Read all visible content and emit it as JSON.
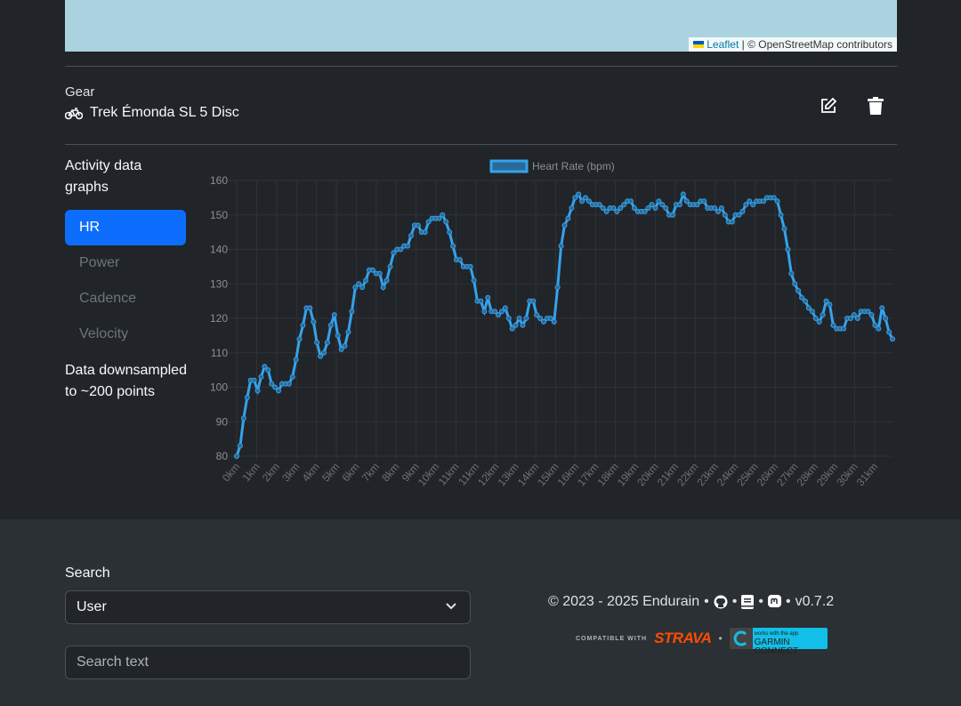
{
  "map": {
    "attribution_link": "Leaflet",
    "attribution_text": "| © OpenStreetMap contributors"
  },
  "gear": {
    "label": "Gear",
    "value": "Trek Émonda SL 5 Disc",
    "icon": "bicycle-icon"
  },
  "sidebar": {
    "title": "Activity data graphs",
    "tabs": [
      {
        "label": "HR",
        "active": true
      },
      {
        "label": "Power"
      },
      {
        "label": "Cadence"
      },
      {
        "label": "Velocity"
      }
    ],
    "note": "Data downsampled to ~200 points"
  },
  "chart_data": {
    "type": "line",
    "legend": "Heart Rate (bpm)",
    "legend_position": "top",
    "color": "#36a2eb",
    "ylim": [
      80,
      160
    ],
    "yticks": [
      80,
      90,
      100,
      110,
      120,
      130,
      140,
      150,
      160
    ],
    "grid": true,
    "xlabels": [
      "0km",
      "1km",
      "2km",
      "3km",
      "4km",
      "5km",
      "6km",
      "7km",
      "8km",
      "9km",
      "10km",
      "11km",
      "11km",
      "12km",
      "13km",
      "14km",
      "15km",
      "16km",
      "17km",
      "18km",
      "19km",
      "20km",
      "21km",
      "22km",
      "23km",
      "24km",
      "25km",
      "26km",
      "27km",
      "28km",
      "29km",
      "30km",
      "31km"
    ],
    "series": [
      {
        "name": "Heart Rate (bpm)",
        "values": [
          80,
          83,
          91,
          97,
          102,
          102,
          99,
          103,
          106,
          105,
          101,
          100,
          99,
          101,
          101,
          101,
          103,
          108,
          114,
          118,
          123,
          123,
          119,
          113,
          109,
          110,
          113,
          118,
          121,
          115,
          111,
          112,
          116,
          122,
          129,
          130,
          129,
          131,
          134,
          134,
          133,
          133,
          129,
          131,
          135,
          139,
          140,
          140,
          141,
          141,
          144,
          147,
          147,
          145,
          145,
          148,
          149,
          149,
          149,
          150,
          148,
          145,
          141,
          137,
          137,
          135,
          135,
          135,
          131,
          125,
          125,
          122,
          126,
          122,
          122,
          121,
          122,
          123,
          120,
          117,
          118,
          120,
          118,
          120,
          125,
          125,
          121,
          120,
          119,
          120,
          120,
          119,
          129,
          141,
          147,
          149,
          152,
          155,
          156,
          154,
          155,
          154,
          153,
          153,
          153,
          152,
          151,
          152,
          152,
          151,
          152,
          153,
          154,
          154,
          152,
          151,
          151,
          151,
          152,
          153,
          152,
          154,
          153,
          152,
          150,
          150,
          153,
          153,
          156,
          154,
          153,
          153,
          153,
          154,
          154,
          152,
          152,
          152,
          151,
          152,
          150,
          148,
          148,
          150,
          150,
          151,
          153,
          154,
          153,
          154,
          154,
          154,
          155,
          155,
          155,
          154,
          150,
          146,
          140,
          133,
          130,
          128,
          126,
          125,
          123,
          122,
          120,
          119,
          121,
          125,
          124,
          118,
          117,
          117,
          117,
          120,
          120,
          121,
          120,
          122,
          122,
          122,
          121,
          118,
          117,
          123,
          120,
          116,
          114
        ]
      }
    ]
  },
  "footer": {
    "search_label": "Search",
    "search_select": "User",
    "search_placeholder": "Search text",
    "copyright": "© 2023 - 2025 Endurain",
    "version": "v0.7.2",
    "compatible_with": "COMPATIBLE WITH",
    "strava": "STRAVA",
    "garmin_small": "works with the app",
    "garmin": "GARMIN CONNECT",
    "sep": "•"
  }
}
